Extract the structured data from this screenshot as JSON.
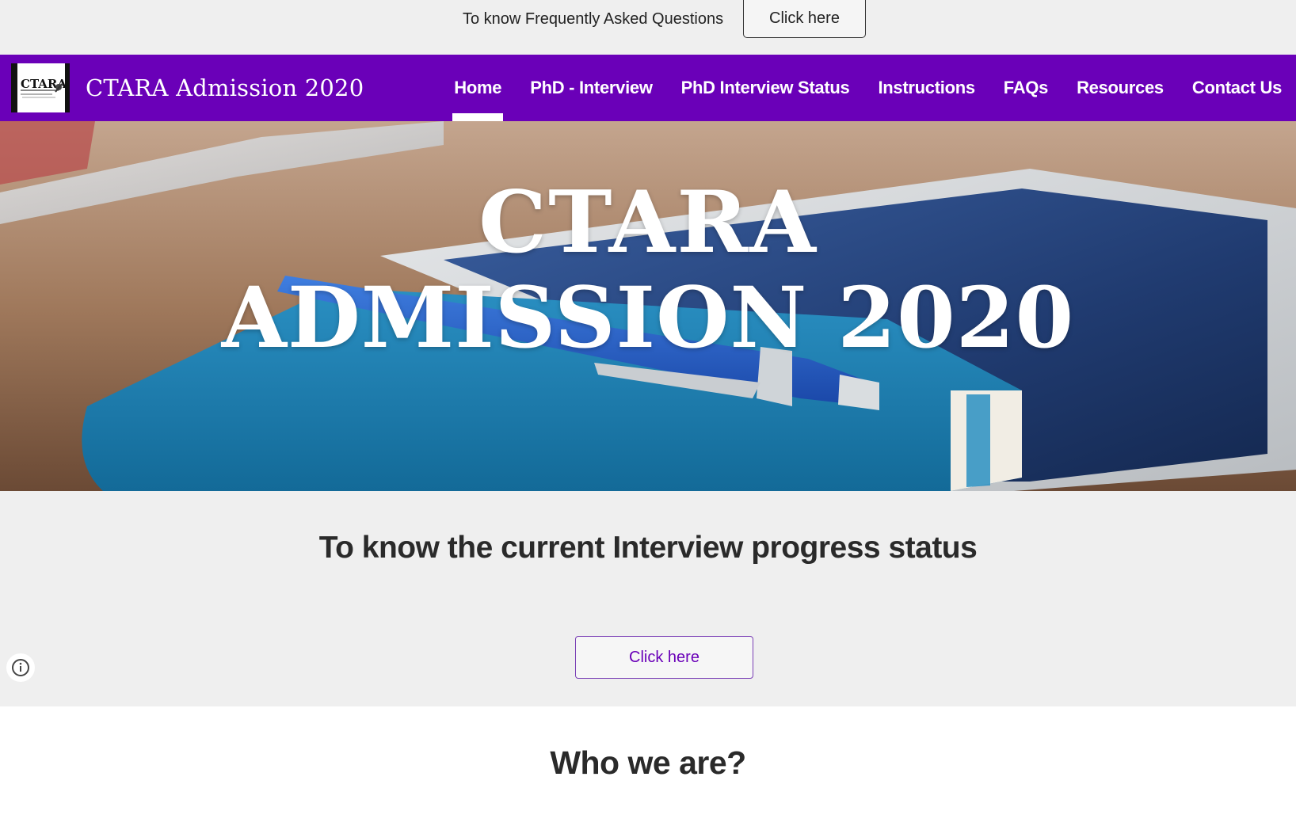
{
  "faq_banner": {
    "text": "To know Frequently Asked Questions",
    "button_label": "Click here"
  },
  "navbar": {
    "logo_text": "CTARA",
    "site_title": "CTARA Admission 2020",
    "items": [
      {
        "label": "Home",
        "active": true
      },
      {
        "label": "PhD - Interview",
        "active": false
      },
      {
        "label": "PhD Interview Status",
        "active": false
      },
      {
        "label": "Instructions",
        "active": false
      },
      {
        "label": "FAQs",
        "active": false
      },
      {
        "label": "Resources",
        "active": false
      },
      {
        "label": "Contact Us",
        "active": false
      }
    ],
    "background_color": "#6a00b8"
  },
  "hero": {
    "title_line1": "CTARA",
    "title_line2": "ADMISSION 2020"
  },
  "status_section": {
    "heading": "To know the current Interview progress status",
    "button_label": "Click here",
    "info_icon": "info-icon"
  },
  "who_section": {
    "heading": "Who we are?"
  }
}
